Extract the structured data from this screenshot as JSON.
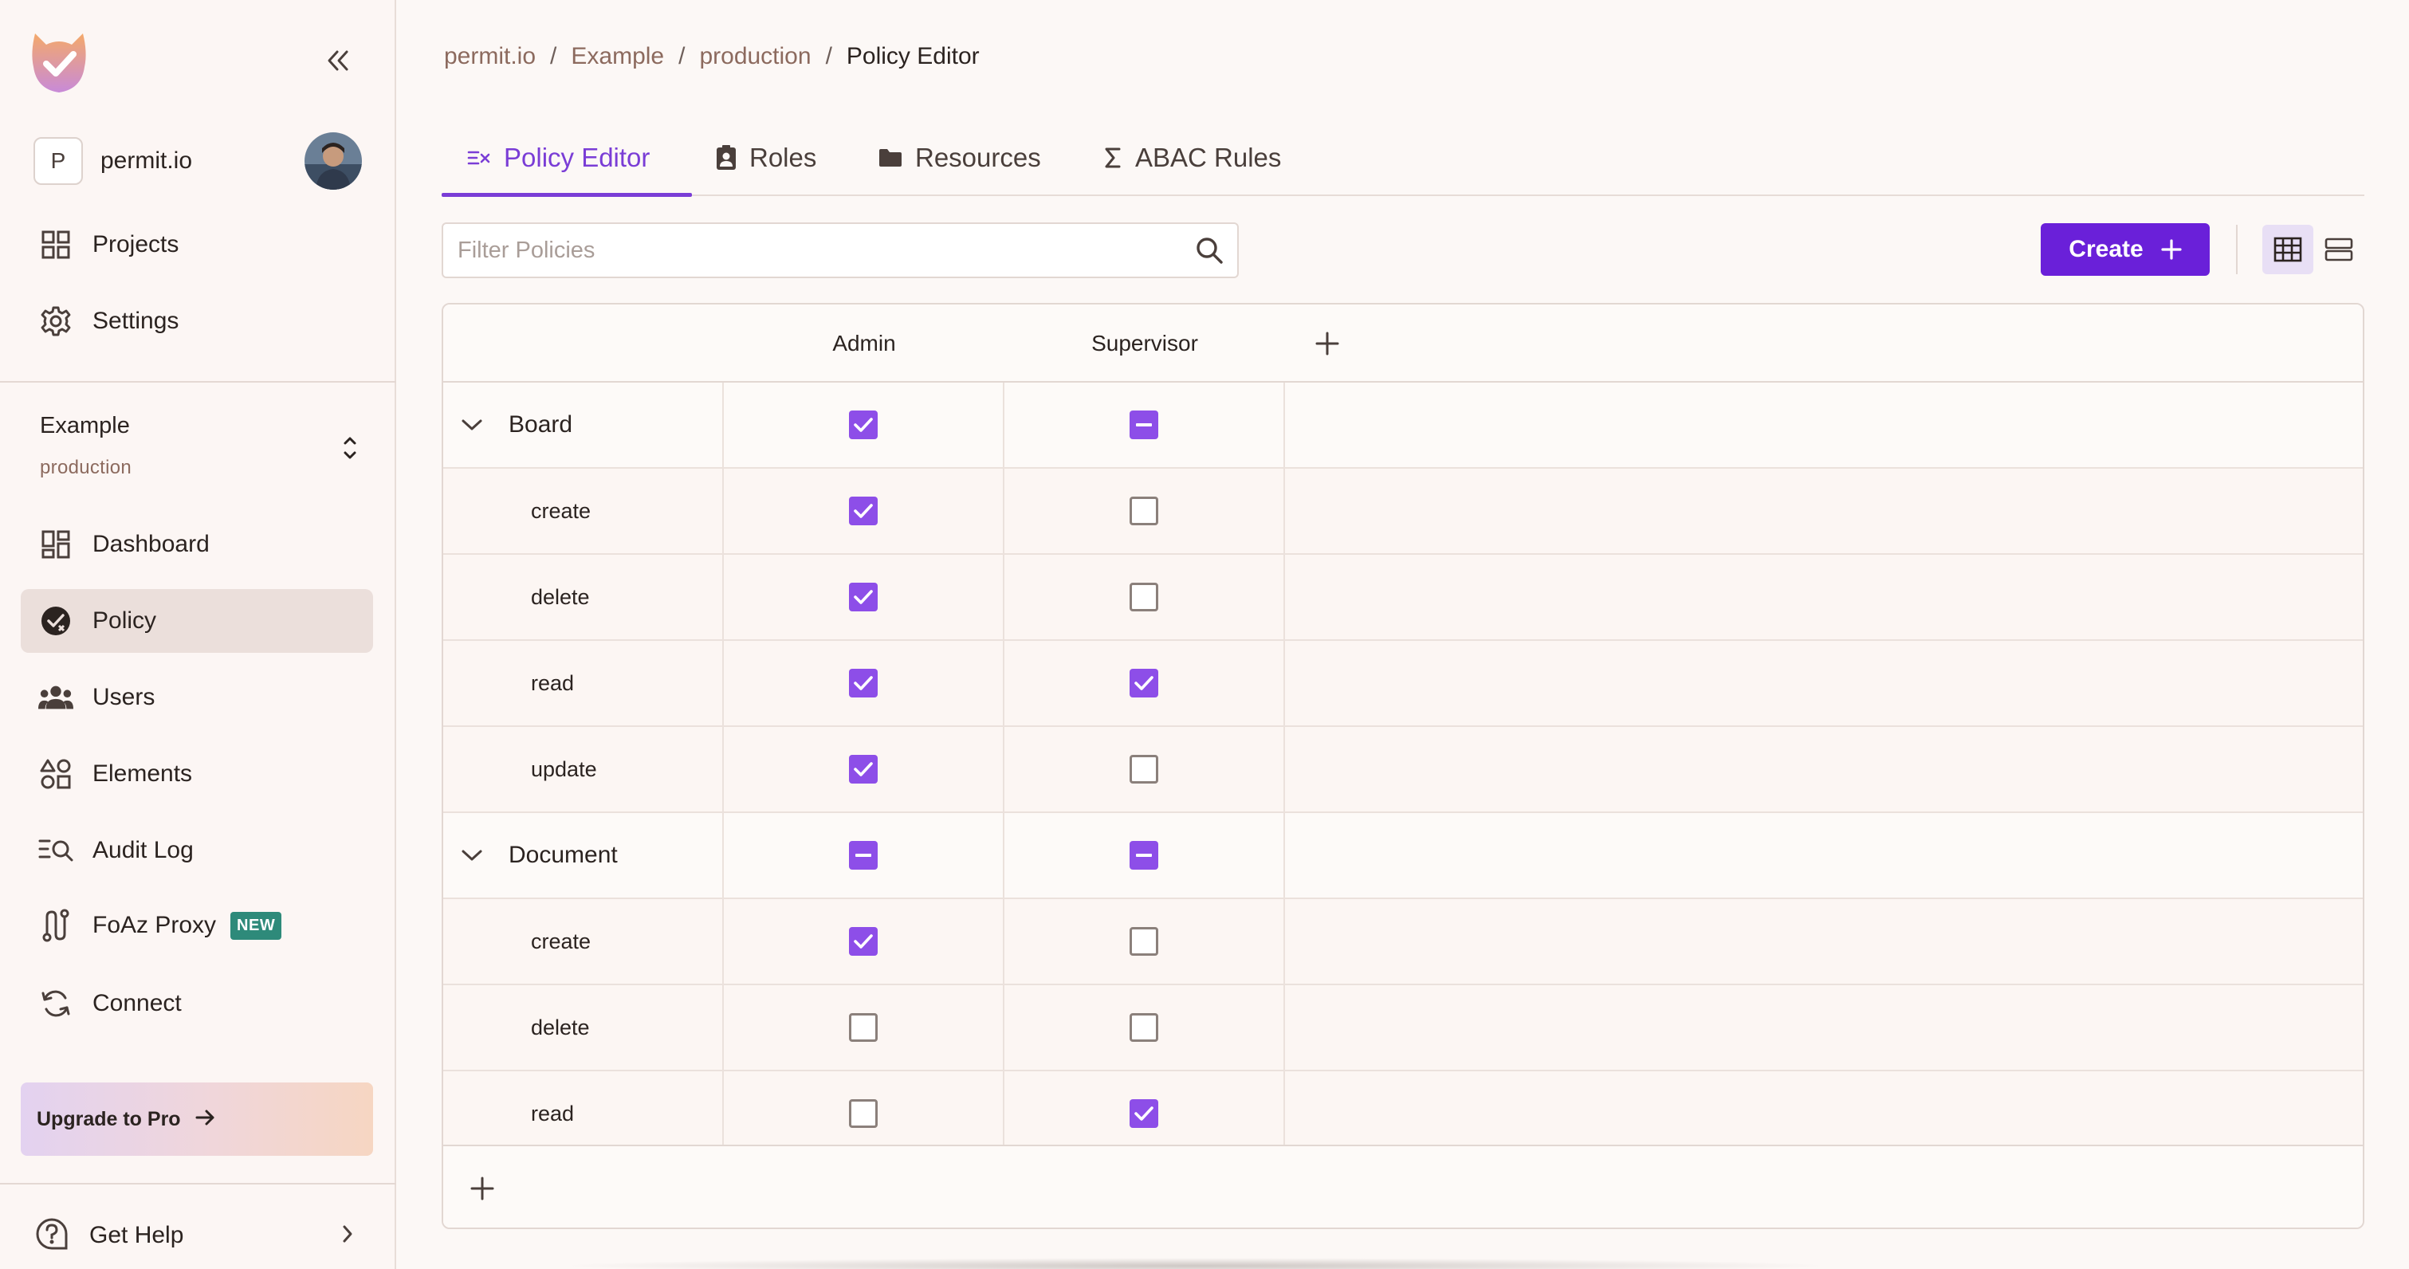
{
  "app": {
    "org_initial": "P",
    "org_name": "permit.io"
  },
  "sidebar": {
    "top_items": [
      {
        "label": "Projects",
        "icon": "grid-icon"
      },
      {
        "label": "Settings",
        "icon": "gear-icon"
      }
    ],
    "env": {
      "project": "Example",
      "environment": "production"
    },
    "items": [
      {
        "label": "Dashboard",
        "icon": "dashboard-icon"
      },
      {
        "label": "Policy",
        "icon": "policy-icon",
        "active": true
      },
      {
        "label": "Users",
        "icon": "users-icon"
      },
      {
        "label": "Elements",
        "icon": "elements-icon"
      },
      {
        "label": "Audit Log",
        "icon": "audit-log-icon"
      },
      {
        "label": "FoAz Proxy",
        "icon": "proxy-icon",
        "badge": "NEW"
      },
      {
        "label": "Connect",
        "icon": "sync-icon"
      }
    ],
    "upgrade_label": "Upgrade to Pro",
    "help_label": "Get Help"
  },
  "breadcrumb": {
    "items": [
      "permit.io",
      "Example",
      "production"
    ],
    "current": "Policy Editor"
  },
  "tabs": [
    {
      "label": "Policy Editor",
      "icon": "policy-editor-icon",
      "active": true
    },
    {
      "label": "Roles",
      "icon": "roles-icon"
    },
    {
      "label": "Resources",
      "icon": "folder-icon"
    },
    {
      "label": "ABAC Rules",
      "icon": "sigma-icon"
    }
  ],
  "filter": {
    "placeholder": "Filter Policies",
    "value": ""
  },
  "create_label": "Create",
  "colors": {
    "accent": "#6a20d9",
    "checkbox": "#8d4ee8",
    "badge": "#2e8a7a"
  },
  "table": {
    "roles": [
      "Admin",
      "Supervisor"
    ],
    "rows": [
      {
        "type": "group",
        "name": "Board",
        "states": [
          "on",
          "partial"
        ]
      },
      {
        "type": "child",
        "name": "create",
        "states": [
          "on",
          "off"
        ]
      },
      {
        "type": "child",
        "name": "delete",
        "states": [
          "on",
          "off"
        ]
      },
      {
        "type": "child",
        "name": "read",
        "states": [
          "on",
          "on"
        ]
      },
      {
        "type": "child",
        "name": "update",
        "states": [
          "on",
          "off"
        ]
      },
      {
        "type": "group",
        "name": "Document",
        "states": [
          "partial",
          "partial"
        ]
      },
      {
        "type": "child",
        "name": "create",
        "states": [
          "on",
          "off"
        ]
      },
      {
        "type": "child",
        "name": "delete",
        "states": [
          "off",
          "off"
        ]
      },
      {
        "type": "child",
        "name": "read",
        "states": [
          "off",
          "on"
        ]
      }
    ]
  }
}
